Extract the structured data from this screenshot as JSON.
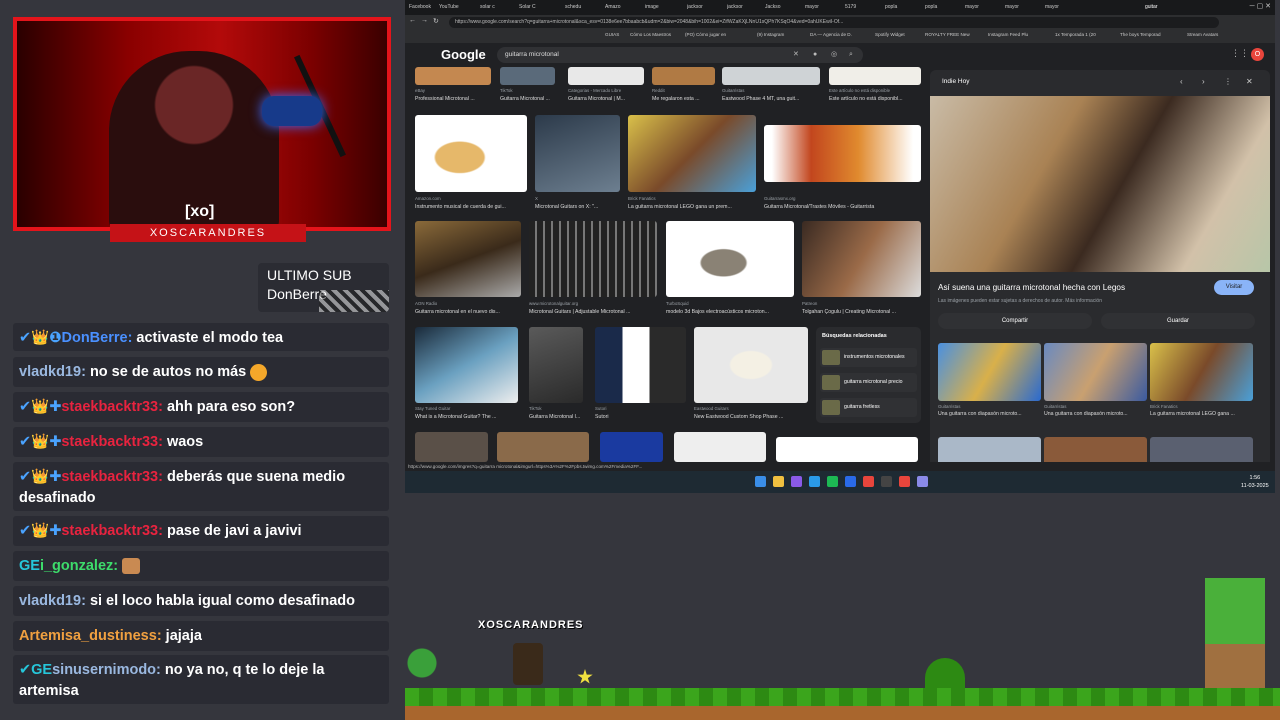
{
  "overlay": {
    "cam_brand": "[xo]",
    "cam_banner": "XOSCARANDRES",
    "sub_label": "ULTIMO SUB",
    "sub_name": "DonBerre"
  },
  "chat": [
    {
      "badges": "✔👑❶",
      "user": "DonBerre",
      "color": "#4a90ff",
      "text": "activaste el modo tea"
    },
    {
      "badges": "",
      "user": "vladkd19",
      "color": "#9ab8e0",
      "text": "no se de autos no más"
    },
    {
      "badges": "✔👑✚",
      "user": "staekbacktr33",
      "color": "#e8233f",
      "text": "ahh para eso son?"
    },
    {
      "badges": "✔👑✚",
      "user": "staekbacktr33",
      "color": "#e8233f",
      "text": "waos"
    },
    {
      "badges": "✔👑✚",
      "user": "staekbacktr33",
      "color": "#e8233f",
      "text": "deberás que suena medio desafinado"
    },
    {
      "badges": "✔👑✚",
      "user": "staekbacktr33",
      "color": "#e8233f",
      "text": "pase de javi a javivi"
    },
    {
      "badges": "GE",
      "user": "i_gonzalez",
      "color": "#3ddc6b",
      "text": ""
    },
    {
      "badges": "",
      "user": "vladkd19",
      "color": "#9ab8e0",
      "text": "si el loco habla igual como desafinado"
    },
    {
      "badges": "",
      "user": "Artemisa_dustiness",
      "color": "#f0a040",
      "text": "jajaja"
    },
    {
      "badges": "✔GE",
      "user": "sinusernimodo",
      "color": "#9ab8e0",
      "text": "no ya no, q te lo deje la artemisa"
    }
  ],
  "browser": {
    "tabs": [
      "Facebook",
      "YouTube",
      "solar c",
      "Solar C",
      "schedu",
      "Amazo",
      "image",
      "jacksor",
      "jacksor",
      "Jackso",
      "mayor",
      "5179",
      "popla",
      "popla",
      "mayor",
      "mayor",
      "mayor",
      "guitar"
    ],
    "url": "https://www.google.com/search?q=guitarra+microtonal&sca_esv=0138e6ee7bbaabcb&udm=2&biw=2048&bih=1002&ei=ZifWZaKXjLNnU1sQPh7KSqO4&ved=0ahUKEwiI-Of...",
    "bookmarks": [
      "GUIAS",
      "Cómo Los Maestros",
      "(PO) Cómo jugar en",
      "(9) Instagram",
      "DA — Agencia de D.",
      "Spotify Widget",
      "ROYALTY FREE New",
      "Instagram Feed Plu",
      "1x Temporada 1 (20",
      "The boys Temporad",
      "Stream Avatars"
    ],
    "search_query": "guitarra microtonal",
    "google": "Google",
    "avatar": "O",
    "status_url": "https://www.google.com/imgres?q=guitarra microtonal&imgurl=https%3A%2F%2Fpbs.twimg.com%2Fmedia%2FF..."
  },
  "results": [
    {
      "src": "eBay",
      "cap": "Professional Microtonal ..."
    },
    {
      "src": "TikTok",
      "cap": "Guitarra Microtonal ..."
    },
    {
      "src": "Categorias - Mercado Libre",
      "cap": "Guitarra Microtonal | M..."
    },
    {
      "src": "Reddit",
      "cap": "Me regalaron esta ..."
    },
    {
      "src": "Guitarristas",
      "cap": "Eastwood Phase 4 MT, una guit..."
    },
    {
      "src": "Este artículo no está disponible",
      "cap": "Este artículo no está disponibl..."
    },
    {
      "src": "Amazon.com",
      "cap": "Instrumento musical de cuerda de gui..."
    },
    {
      "src": "X",
      "cap": "Microtonal Guitars on X: \"..."
    },
    {
      "src": "Brick Fanatics",
      "cap": "La guitarra microtonal LEGO gana un prem..."
    },
    {
      "src": "Guitarrasmx.org",
      "cap": "Guitarra Microtonal/Trastes Móviles - Guitarrista"
    },
    {
      "src": "AON Radio",
      "cap": "Guitarra microtonal en el nuevo dis..."
    },
    {
      "src": "www.microtonalguitar.org",
      "cap": "Microtonal Guitars | Adjustable Microtonal ..."
    },
    {
      "src": "TurboSquid",
      "cap": "modelo 3d Bajos electroacústicos microton..."
    },
    {
      "src": "Patreon",
      "cap": "Tolgahan Çogulu | Creating Microtonal ..."
    },
    {
      "src": "Stay Tuned Guitar",
      "cap": "What is a Microtonal Guitar? The ..."
    },
    {
      "src": "TikTok",
      "cap": "Guitarra Microtonal I..."
    },
    {
      "src": "Sutori",
      "cap": "Sutori"
    },
    {
      "src": "Eastwood Guitars",
      "cap": "New Eastwood Custom Shop Phase ..."
    }
  ],
  "related": {
    "heading": "Búsquedas relacionadas",
    "items": [
      "instrumentos microtonales",
      "guitarra microtonal precio",
      "guitarra fretless"
    ]
  },
  "panel": {
    "site": "Indie Hoy",
    "title": "Así suena una guitarra microtonal hecha con Legos",
    "note": "Las imágenes pueden estar sujetas a derechos de autor. Más información",
    "visit": "Visitar",
    "share": "Compartir",
    "save": "Guardar",
    "related": [
      {
        "src": "Guitarristas",
        "cap": "Una guitarra con diapasón microto..."
      },
      {
        "src": "Guitarristas",
        "cap": "Una guitarra con diapasón microto..."
      },
      {
        "src": "Brick Fanatics",
        "cap": "La guitarra microtonal LEGO gana ..."
      }
    ]
  },
  "taskbar": {
    "time": "1:56",
    "date": "11-03-2025"
  },
  "game": {
    "title": "XOSCARANDRES"
  }
}
